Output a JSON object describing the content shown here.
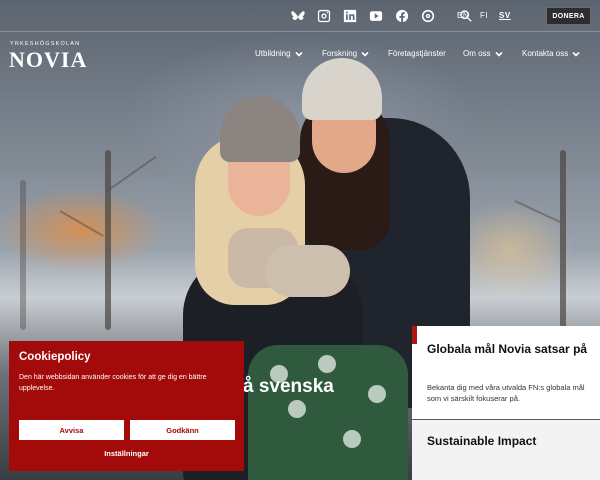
{
  "topbar": {
    "icons": [
      "bluesky-icon",
      "instagram-icon",
      "linkedin-icon",
      "youtube-icon",
      "facebook-icon",
      "threads-icon",
      "search-icon"
    ],
    "languages": [
      "EN",
      "FI",
      "SV"
    ],
    "active_language": "SV",
    "donate_label": "DONERA"
  },
  "header": {
    "logo_small": "YRKESHÖGSKOLAN",
    "logo_big": "NOVIA",
    "nav": [
      {
        "label": "Utbildning",
        "has_dropdown": true
      },
      {
        "label": "Forskning",
        "has_dropdown": true
      },
      {
        "label": "Företagstjänster",
        "has_dropdown": false
      },
      {
        "label": "Om oss",
        "has_dropdown": true
      },
      {
        "label": "Kontakta oss",
        "has_dropdown": true
      }
    ]
  },
  "hero": {
    "title_fragment": "å svenska"
  },
  "cards": {
    "goals_title": "Globala mål Novia satsar på",
    "goals_text": "Bekanta dig med våra utvalda FN:s globala mål som vi särskilt fokuserar på.",
    "impact_title": "Sustainable Impact"
  },
  "cookie": {
    "title": "Cookiepolicy",
    "text": "Den här webbsidan använder cookies för att ge dig en bättre upplevelse.",
    "reject_label": "Avvisa",
    "accept_label": "Godkänn",
    "settings_label": "Inställningar"
  },
  "colors": {
    "brand_red": "#a30a0a",
    "accent_red": "#b01515",
    "donate_bg": "#2b2d31"
  }
}
